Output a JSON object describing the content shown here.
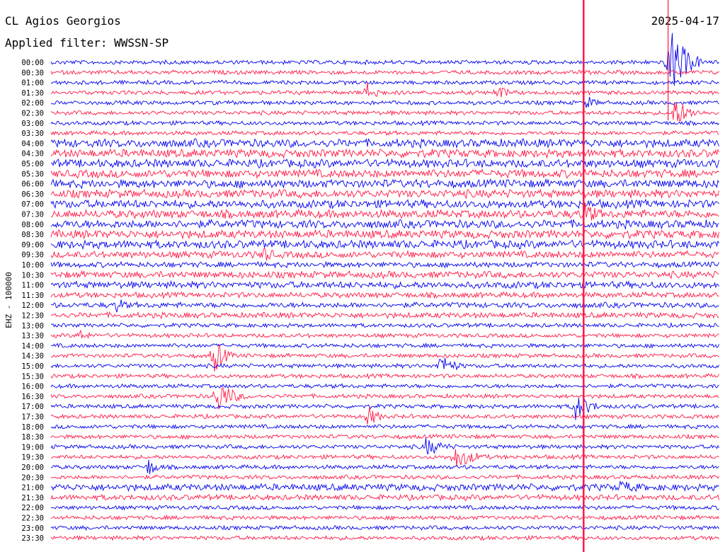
{
  "header": {
    "station": "CL Agios Georgios",
    "date": "2025-04-17",
    "filter": "Applied filter: WWSSN-SP"
  },
  "chart_data": {
    "type": "line",
    "ylabel": "EHZ - 100000",
    "row_labels": [
      "00:00",
      "00:30",
      "01:00",
      "01:30",
      "02:00",
      "02:30",
      "03:00",
      "03:30",
      "04:00",
      "04:30",
      "05:00",
      "05:30",
      "06:00",
      "06:30",
      "07:00",
      "07:30",
      "08:00",
      "08:30",
      "09:00",
      "09:30",
      "10:00",
      "10:30",
      "11:00",
      "11:30",
      "12:00",
      "12:30",
      "13:00",
      "13:30",
      "14:00",
      "14:30",
      "15:00",
      "15:30",
      "16:00",
      "16:30",
      "17:00",
      "17:30",
      "18:00",
      "18:30",
      "19:00",
      "19:30",
      "20:00",
      "20:30",
      "21:00",
      "21:30",
      "22:00",
      "22:30",
      "23:00",
      "23:30"
    ],
    "series_colors": [
      "#0000ee",
      "#ff1744"
    ],
    "trace_minutes": 30,
    "noise_amplitude": [
      3,
      3,
      3,
      3,
      3,
      3,
      3,
      3,
      6,
      6,
      6,
      6,
      6,
      6,
      6,
      6,
      6,
      6,
      6,
      5,
      4,
      5,
      5,
      4,
      4,
      4,
      3,
      3,
      3,
      3,
      3,
      3,
      3,
      3,
      3,
      3,
      3,
      3,
      3,
      3,
      3,
      3,
      5,
      4,
      3,
      3,
      3,
      3
    ],
    "events": [
      {
        "row": 0,
        "minute": 27.7,
        "amplitude": 60,
        "duration_min": 1.5
      },
      {
        "row": 3,
        "minute": 14.2,
        "amplitude": 18,
        "duration_min": 1
      },
      {
        "row": 3,
        "minute": 20.0,
        "amplitude": 14,
        "duration_min": 1
      },
      {
        "row": 4,
        "minute": 24.0,
        "amplitude": 12,
        "duration_min": 1
      },
      {
        "row": 5,
        "minute": 27.9,
        "amplitude": 24,
        "duration_min": 1.5
      },
      {
        "row": 15,
        "minute": 23.8,
        "amplitude": 22,
        "duration_min": 1.5
      },
      {
        "row": 19,
        "minute": 9.5,
        "amplitude": 16,
        "duration_min": 1
      },
      {
        "row": 24,
        "minute": 2.9,
        "amplitude": 14,
        "duration_min": 1
      },
      {
        "row": 27,
        "minute": 1.2,
        "amplitude": 12,
        "duration_min": 1
      },
      {
        "row": 29,
        "minute": 7.3,
        "amplitude": 30,
        "duration_min": 1
      },
      {
        "row": 30,
        "minute": 17.4,
        "amplitude": 18,
        "duration_min": 1.5
      },
      {
        "row": 33,
        "minute": 7.4,
        "amplitude": 28,
        "duration_min": 1.5
      },
      {
        "row": 34,
        "minute": 23.5,
        "amplitude": 22,
        "duration_min": 1.5
      },
      {
        "row": 35,
        "minute": 14.2,
        "amplitude": 18,
        "duration_min": 1
      },
      {
        "row": 38,
        "minute": 16.8,
        "amplitude": 14,
        "duration_min": 2
      },
      {
        "row": 39,
        "minute": 18.1,
        "amplitude": 18,
        "duration_min": 2
      },
      {
        "row": 40,
        "minute": 4.3,
        "amplitude": 16,
        "duration_min": 1
      },
      {
        "row": 42,
        "minute": 25.5,
        "amplitude": 10,
        "duration_min": 3
      }
    ],
    "big_quake": {
      "minute": 23.9
    }
  }
}
